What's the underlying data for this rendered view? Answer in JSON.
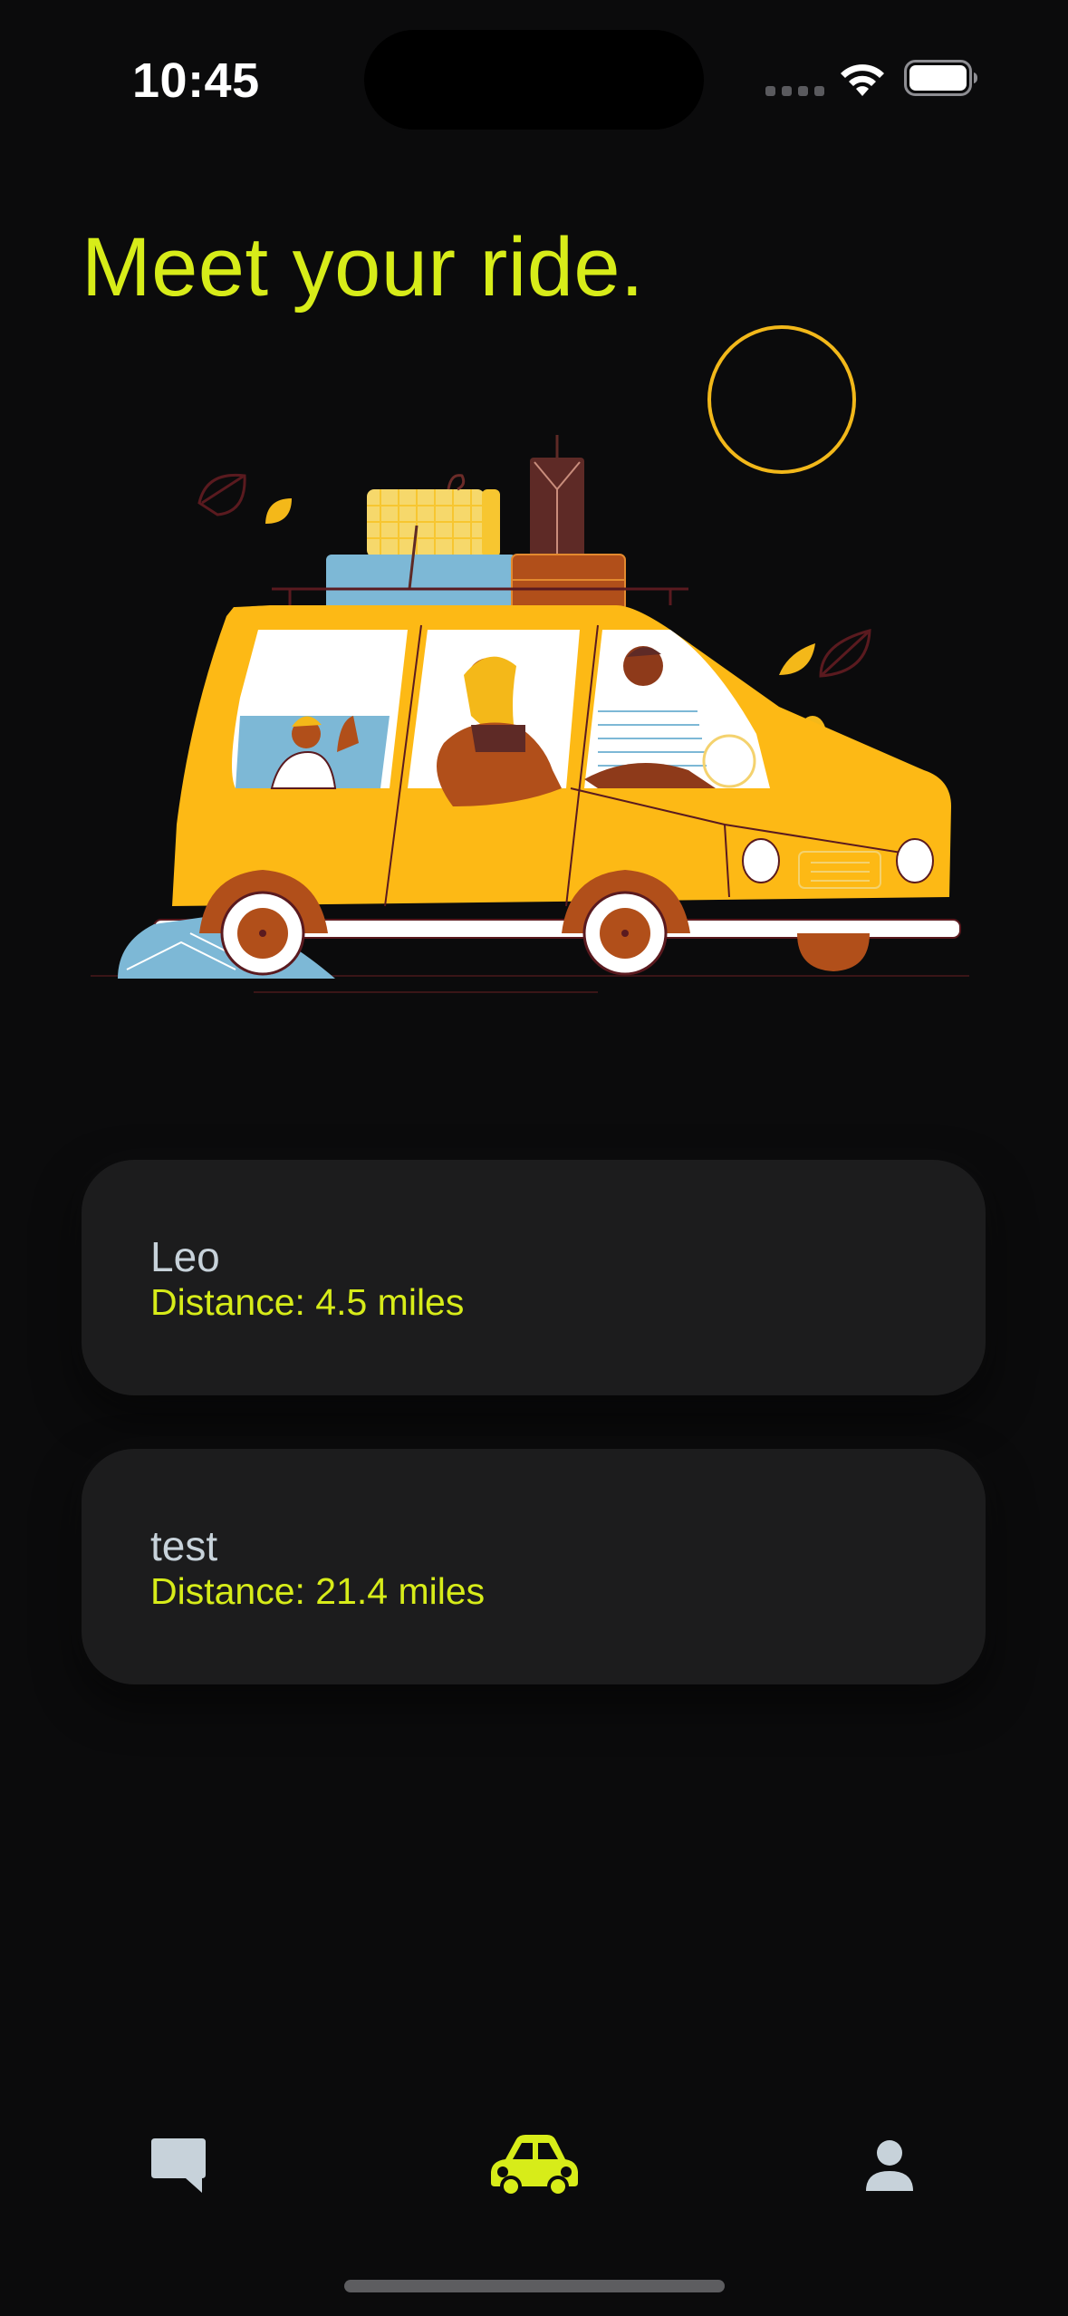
{
  "status_bar": {
    "time": "10:45",
    "icons": [
      "cellular-signal-icon",
      "wifi-icon",
      "battery-icon"
    ]
  },
  "header": {
    "title": "Meet your ride."
  },
  "illustration": {
    "icon": "car-trip-illustration"
  },
  "rides": [
    {
      "name": "Leo",
      "distance": "Distance: 4.5 miles"
    },
    {
      "name": "test",
      "distance": "Distance: 21.4 miles"
    }
  ],
  "tab_bar": {
    "tabs": [
      {
        "icon": "chat-bubble-icon",
        "active": false
      },
      {
        "icon": "car-icon",
        "active": true
      },
      {
        "icon": "person-icon",
        "active": false
      }
    ]
  },
  "colors": {
    "background": "#0b0b0c",
    "accent": "#d7ec19",
    "card": "#1c1c1d",
    "muted_text": "#c7d2da",
    "car_yellow": "#fdb915"
  }
}
